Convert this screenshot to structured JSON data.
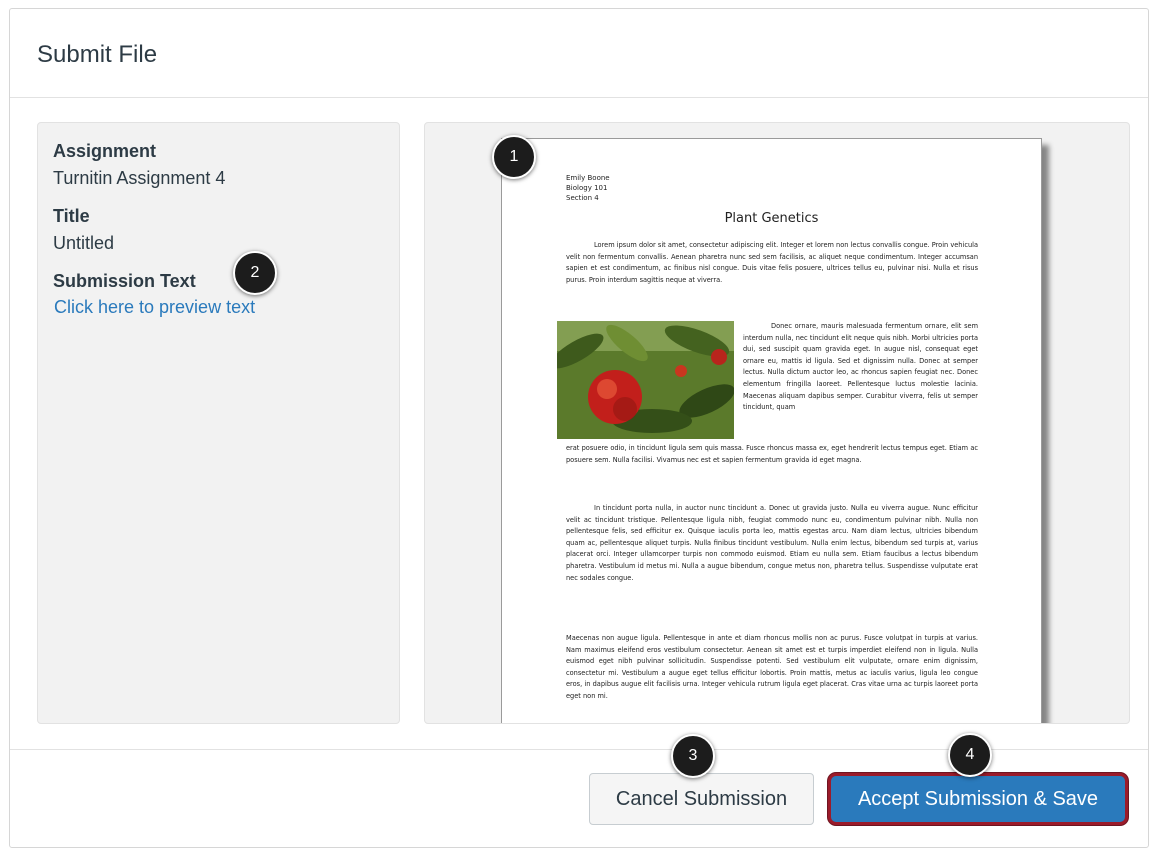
{
  "dialog": {
    "title": "Submit File"
  },
  "info": {
    "assignment_label": "Assignment",
    "assignment_value": "Turnitin Assignment 4",
    "title_label": "Title",
    "title_value": "Untitled",
    "submission_text_label": "Submission Text",
    "preview_link": "Click here to preview text"
  },
  "document": {
    "author": "Emily Boone",
    "course": "Biology 101",
    "section": "Section 4",
    "title": "Plant Genetics",
    "paragraphs": [
      "Lorem ipsum dolor sit amet, consectetur adipiscing elit. Integer et lorem non lectus convallis congue. Proin vehicula velit non fermentum convallis. Aenean pharetra nunc sed sem facilisis, ac aliquet neque condimentum. Integer accumsan sapien et est condimentum, ac finibus nisl congue. Duis vitae felis posuere, ultrices tellus eu, pulvinar nisi. Nulla et risus purus. Proin interdum sagittis neque at viverra.",
      "Donec ornare, mauris malesuada fermentum ornare, elit sem interdum nulla, nec tincidunt elit neque quis nibh. Morbi ultricies porta dui, sed suscipit quam gravida eget. In augue nisl, consequat eget ornare eu, mattis id ligula. Sed et dignissim nulla. Donec at semper lectus. Nulla dictum auctor leo, ac rhoncus sapien feugiat nec. Donec elementum fringilla laoreet. Pellentesque luctus molestie lacinia. Maecenas aliquam dapibus semper. Curabitur viverra, felis ut semper tincidunt, quam",
      "erat posuere odio, in tincidunt ligula sem quis massa. Fusce rhoncus massa ex, eget hendrerit lectus tempus eget. Etiam ac posuere sem. Nulla facilisi. Vivamus nec est et sapien fermentum gravida id eget magna.",
      "In tincidunt porta nulla, in auctor nunc tincidunt a. Donec ut gravida justo. Nulla eu viverra augue. Nunc efficitur velit ac tincidunt tristique. Pellentesque ligula nibh, feugiat commodo nunc eu, condimentum pulvinar nibh. Nulla non pellentesque felis, sed efficitur ex. Quisque iaculis porta leo, mattis egestas arcu. Nam diam lectus, ultricies bibendum quam ac, pellentesque aliquet turpis. Nulla finibus tincidunt vestibulum. Nulla enim lectus, bibendum sed turpis at, varius placerat orci. Integer ullamcorper turpis non commodo euismod. Etiam eu nulla sem. Etiam faucibus a lectus bibendum pharetra. Vestibulum id metus mi. Nulla a augue bibendum, congue metus non, pharetra tellus. Suspendisse vulputate erat nec sodales congue.",
      "Maecenas non augue ligula. Pellentesque in ante et diam rhoncus mollis non ac purus. Fusce volutpat in turpis at varius. Nam maximus eleifend eros vestibulum consectetur. Aenean sit amet est et turpis imperdiet eleifend non in ligula. Nulla euismod eget nibh pulvinar sollicitudin. Suspendisse potenti. Sed vestibulum elit vulputate, ornare enim dignissim, consectetur mi. Vestibulum a augue eget tellus efficitur lobortis. Proin mattis, metus ac iaculis varius, ligula leo congue eros, in dapibus augue elit facilisis urna. Integer vehicula rutrum ligula eget placerat. Cras vitae urna ac turpis laoreet porta eget non mi."
    ]
  },
  "callouts": [
    "1",
    "2",
    "3",
    "4"
  ],
  "buttons": {
    "cancel": "Cancel Submission",
    "accept": "Accept Submission & Save"
  },
  "colors": {
    "link": "#2a7abc",
    "primary_button": "#2a7abc",
    "highlight_border": "#9b1b2a",
    "callout_badge": "#1c1c1c"
  }
}
